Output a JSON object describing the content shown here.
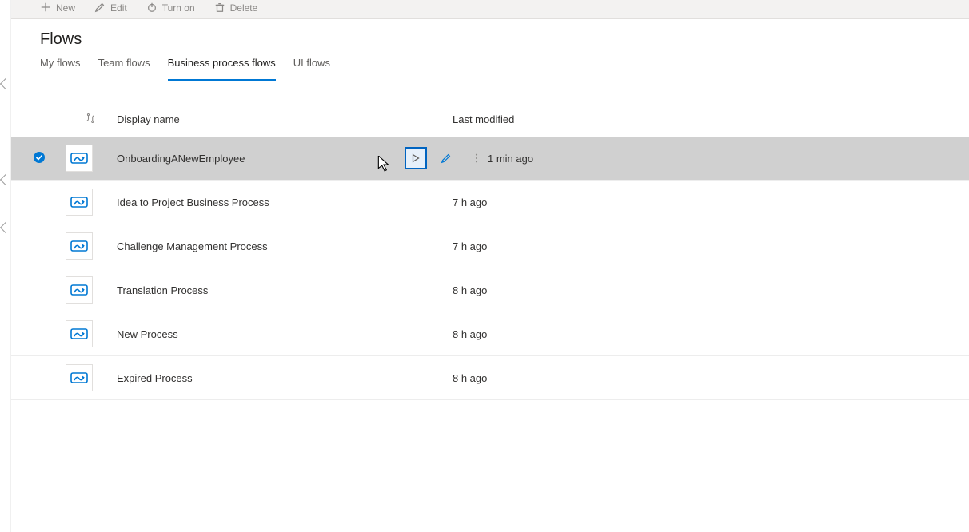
{
  "toolbar": {
    "new": "New",
    "edit": "Edit",
    "turnon": "Turn on",
    "delete": "Delete"
  },
  "page": {
    "title": "Flows"
  },
  "tabs": {
    "my": "My flows",
    "team": "Team flows",
    "bpf": "Business process flows",
    "ui": "UI flows",
    "active": "bpf"
  },
  "columns": {
    "name": "Display name",
    "last": "Last modified"
  },
  "rows": [
    {
      "selected": true,
      "name": "OnboardingANewEmployee",
      "last": "1 min ago",
      "show_actions": true
    },
    {
      "selected": false,
      "name": "Idea to Project Business Process",
      "last": "7 h ago",
      "show_actions": false
    },
    {
      "selected": false,
      "name": "Challenge Management Process",
      "last": "7 h ago",
      "show_actions": false
    },
    {
      "selected": false,
      "name": "Translation Process",
      "last": "8 h ago",
      "show_actions": false
    },
    {
      "selected": false,
      "name": "New Process",
      "last": "8 h ago",
      "show_actions": false
    },
    {
      "selected": false,
      "name": "Expired Process",
      "last": "8 h ago",
      "show_actions": false
    }
  ]
}
